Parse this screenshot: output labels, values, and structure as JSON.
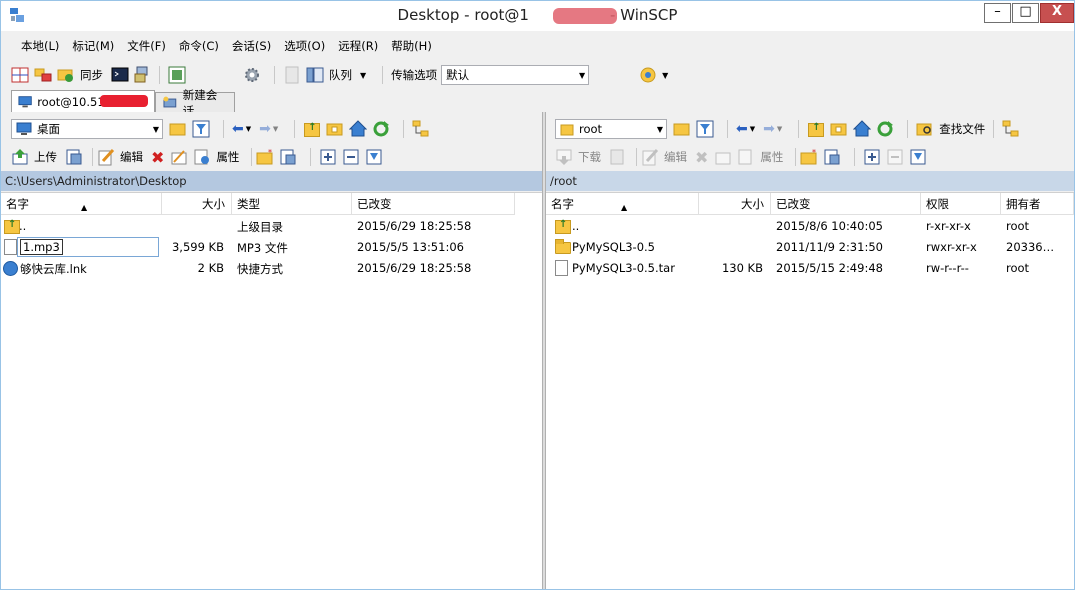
{
  "window": {
    "title": "Desktop - root@1                 - WinSCP",
    "min": "–",
    "max": "□",
    "close": "X"
  },
  "menu": [
    "本地(L)",
    "标记(M)",
    "文件(F)",
    "命令(C)",
    "会话(S)",
    "选项(O)",
    "远程(R)",
    "帮助(H)"
  ],
  "toolbar": {
    "sync_label": "同步",
    "queue_label": "队列",
    "transfer_label": "传输选项",
    "transfer_value": "默认"
  },
  "tabs": {
    "session": "root@10.51",
    "session_tail": "5",
    "new_session": "新建会话"
  },
  "left": {
    "location": "桌面",
    "upload": "上传",
    "edit": "编辑",
    "properties": "属性",
    "path": "C:\\Users\\Administrator\\Desktop",
    "columns": {
      "name": "名字",
      "size": "大小",
      "type": "类型",
      "changed": "已改变"
    },
    "rows": [
      {
        "name": "..",
        "size": "",
        "type": "上级目录",
        "changed": "2015/6/29  18:25:58",
        "icon": "parent-folder-icon"
      },
      {
        "name": "1.mp3",
        "size": "3,599 KB",
        "type": "MP3 文件",
        "changed": "2015/5/5  13:51:06",
        "icon": "document-icon"
      },
      {
        "name": "够快云库.lnk",
        "size": "2 KB",
        "type": "快捷方式",
        "changed": "2015/6/29  18:25:58",
        "icon": "shortcut-icon"
      }
    ]
  },
  "right": {
    "location": "root",
    "find": "查找文件",
    "download": "下载",
    "edit": "编辑",
    "properties": "属性",
    "path": "/root",
    "columns": {
      "name": "名字",
      "size": "大小",
      "changed": "已改变",
      "rights": "权限",
      "owner": "拥有者"
    },
    "rows": [
      {
        "name": "..",
        "size": "",
        "changed": "2015/8/6 10:40:05",
        "rights": "r-xr-xr-x",
        "owner": "root",
        "icon": "parent-folder-icon"
      },
      {
        "name": "PyMySQL3-0.5",
        "size": "",
        "changed": "2011/11/9 2:31:50",
        "rights": "rwxr-xr-x",
        "owner": "20336…",
        "icon": "folder-icon"
      },
      {
        "name": "PyMySQL3-0.5.tar",
        "size": "130 KB",
        "changed": "2015/5/15 2:49:48",
        "rights": "rw-r--r--",
        "owner": "root",
        "icon": "document-icon"
      }
    ]
  }
}
